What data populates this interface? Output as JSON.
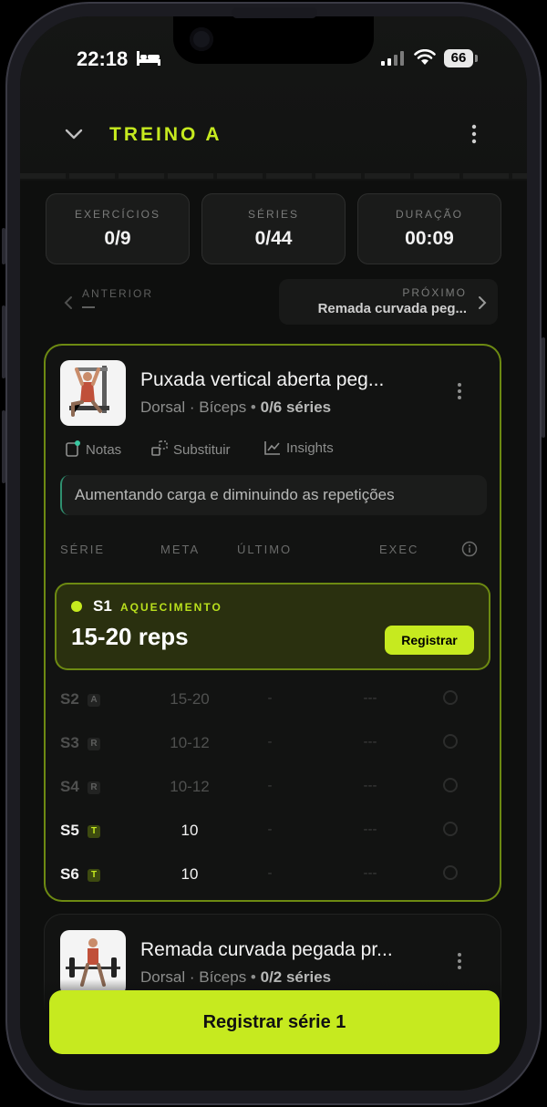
{
  "status_bar": {
    "time": "22:18",
    "battery": "66"
  },
  "header": {
    "title": "TREINO A"
  },
  "stats": [
    {
      "label": "EXERCÍCIOS",
      "value": "0/9"
    },
    {
      "label": "SÉRIES",
      "value": "0/44"
    },
    {
      "label": "DURAÇÃO",
      "value": "00:09"
    }
  ],
  "nav": {
    "previous_label": "ANTERIOR",
    "next_label": "PRÓXIMO",
    "next_name": "Remada curvada peg..."
  },
  "exercise": {
    "name": "Puxada vertical aberta peg...",
    "muscles": "Dorsal · Bíceps •",
    "sets_progress": "0/6 séries",
    "tools": {
      "notes": "Notas",
      "substitute": "Substituir",
      "insights": "Insights"
    },
    "note": "Aumentando carga e diminuindo as repetições",
    "columns": {
      "set": "SÉRIE",
      "target": "META",
      "last": "ÚLTIMO",
      "exec": "EXEC"
    },
    "active_set": {
      "number": "S1",
      "type": "AQUECIMENTO",
      "target": "15-20 reps",
      "button": "Registrar"
    },
    "sets": [
      {
        "number": "S2",
        "tag": "A",
        "target": "15-20",
        "last": "-",
        "exec": "---"
      },
      {
        "number": "S3",
        "tag": "R",
        "target": "10-12",
        "last": "-",
        "exec": "---"
      },
      {
        "number": "S4",
        "tag": "R",
        "target": "10-12",
        "last": "-",
        "exec": "---"
      },
      {
        "number": "S5",
        "tag": "T",
        "target": "10",
        "last": "-",
        "exec": "---"
      },
      {
        "number": "S6",
        "tag": "T",
        "target": "10",
        "last": "-",
        "exec": "---"
      }
    ]
  },
  "next_exercise": {
    "name": "Remada curvada pegada pr...",
    "muscles": "Dorsal · Bíceps •",
    "sets_progress": "0/2 séries"
  },
  "cta": {
    "label": "Registrar série 1"
  },
  "colors": {
    "accent": "#c6ea1f",
    "background": "#0e0f0e",
    "card": "#121312"
  }
}
